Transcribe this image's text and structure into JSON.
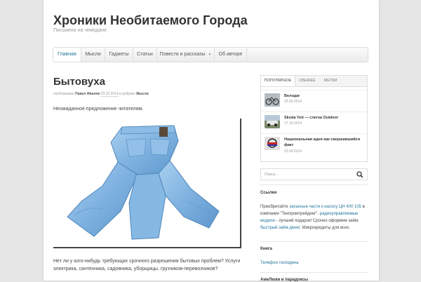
{
  "site": {
    "title": "Хроники Необитаемого Города",
    "description": "Письмена на чемодане"
  },
  "nav": {
    "items": [
      {
        "label": "Главная",
        "active": true
      },
      {
        "label": "Мысли"
      },
      {
        "label": "Гаджеты"
      },
      {
        "label": "Статьи"
      },
      {
        "label": "Повести и рассказы",
        "has_dropdown": true
      },
      {
        "label": "Об авторе"
      }
    ]
  },
  "post": {
    "title": "Бытовуха",
    "meta": {
      "prefix": "опубликовал",
      "author": "Павел Ивалев",
      "date": "29.10.2014",
      "category_prefix": "в рубрике",
      "category": "Мысли"
    },
    "intro": "Неожиданное предложение читателям.",
    "body": "Нет ли у кого-нибудь требующих срочного разрешения бытовых проблем? Услуги электрика, сантехника, садовника, уборщицы, грузчиков-перевозчиков?"
  },
  "sidebar": {
    "tabs": [
      {
        "label": "ПОПУЛЯРНОЕ",
        "active": true
      },
      {
        "label": "СВЕЖЕЕ"
      },
      {
        "label": "МЕТКИ"
      }
    ],
    "popular": [
      {
        "title": "Велодаг",
        "date": "25.09.2014"
      },
      {
        "title": "Skoda Yeti — слегка Outdoor",
        "date": "17.10.2014"
      },
      {
        "title": "Национальная идея как свершившийся факт",
        "date": "23.09.2014"
      }
    ],
    "search": {
      "placeholder": "Поиск..."
    },
    "links": {
      "title": "Ссылки",
      "text1": "Приобретайте",
      "link1": "запасные части к насосу ЦН 400 105",
      "text2": "в компании \"Техпромтрейдинг\".",
      "link2": "радиоуправляемые модели",
      "text3": "- лучший подарок! Срочно оформим займ:",
      "link3": "быстрый займ денег",
      "text4": ". Микрокредиты для всех."
    },
    "book": {
      "title": "Книга",
      "link": "Телефон господень"
    },
    "next_title": "АмеЛюки и парадоксы"
  },
  "colors": {
    "link": "#21759b",
    "page_bg": "#e6e6e6"
  }
}
